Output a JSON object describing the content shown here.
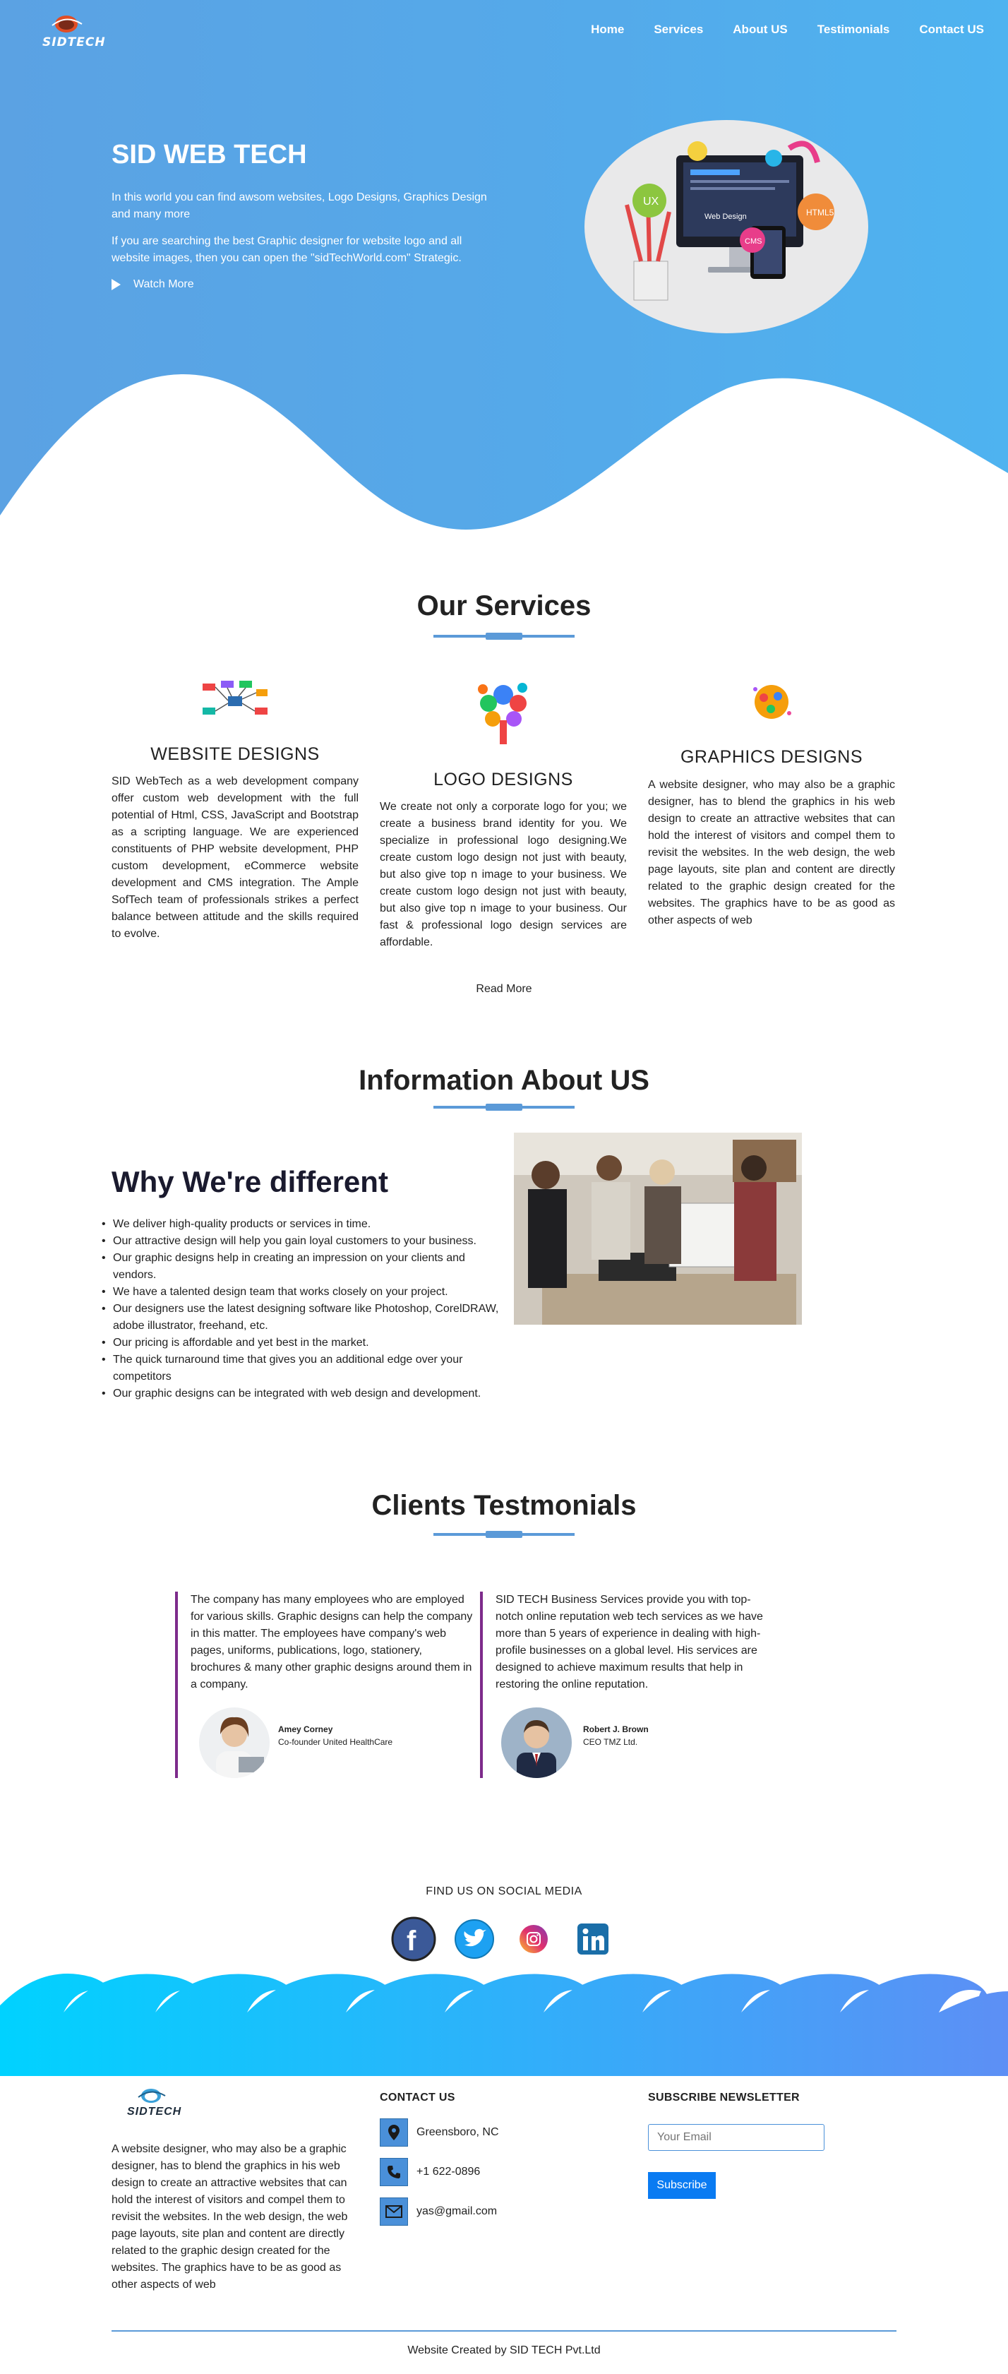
{
  "brand": {
    "logo_text": "SIDTECH"
  },
  "nav": [
    "Home",
    "Services",
    "About US",
    "Testimonials",
    "Contact US"
  ],
  "hero": {
    "title": "SID WEB TECH",
    "p1": "In this world you can find awsom websites, Logo Designs, Graphics Design and many more",
    "p2": "If you are searching the best Graphic designer for website logo and all website images, then you can open the \"sidTechWorld.com\" Strategic.",
    "watch_label": "Watch More",
    "illustration_labels": [
      "UX",
      "HTML5",
      "CMS",
      "Web Design"
    ]
  },
  "services": {
    "title": "Our Services",
    "items": [
      {
        "title": "WEBSITE DESIGNS",
        "text": "SID WebTech as a web development company offer custom web development with the full potential of Html, CSS, JavaScript and Bootstrap as a scripting language. We are experienced constituents of PHP website development, PHP custom development, eCommerce website development and CMS integration. The Ample SofTech team of professionals strikes a perfect balance between attitude and the skills required to evolve."
      },
      {
        "title": "LOGO DESIGNS",
        "text": "We create not only a corporate logo for you; we create a business brand identity for you. We specialize in professional logo designing.We create custom logo design not just with beauty, but also give top n image to your business. We create custom logo design not just with beauty, but also give top n image to your business. Our fast & professional logo design services are affordable."
      },
      {
        "title": "GRAPHICS DESIGNS",
        "text": "A website designer, who may also be a graphic designer, has to blend the graphics in his web design to create an attractive websites that can hold the interest of visitors and compel them to revisit the websites. In the web design, the web page layouts, site plan and content are directly related to the graphic design created for the websites. The graphics have to be as good as other aspects of web"
      }
    ],
    "read_more": "Read More"
  },
  "about": {
    "title": "Information About US",
    "heading": "Why We're different",
    "points": [
      "We deliver high-quality products or services in time.",
      "Our attractive design will help you gain loyal customers to your business.",
      "Our graphic designs help in creating an impression on your clients and vendors.",
      "We have a talented design team that works closely on your project.",
      "Our designers use the latest designing software like Photoshop, CorelDRAW, adobe illustrator, freehand, etc.",
      "Our pricing is affordable and yet best in the market.",
      "The quick turnaround time that gives you an additional edge over your competitors",
      "Our graphic designs can be integrated with web design and development."
    ]
  },
  "testimonials": {
    "title": "Clients Testmonials",
    "items": [
      {
        "text": "The company has many employees who are employed for various skills. Graphic designs can help the company in this matter. The employees have company's web pages, uniforms, publications, logo, stationery, brochures & many other graphic designs around them in a company.",
        "name": "Amey Corney",
        "role": "Co-founder United HealthCare"
      },
      {
        "text": "SID TECH Business Services provide you with top-notch online reputation web tech services as we have more than 5 years of experience in dealing with high-profile businesses on a global level. His services are designed to achieve maximum results that help in restoring the online reputation.",
        "name": "Robert J. Brown",
        "role": "CEO TMZ Ltd."
      }
    ]
  },
  "social": {
    "title": "FIND US ON SOCIAL MEDIA",
    "icons": [
      "facebook-icon",
      "twitter-icon",
      "instagram-icon",
      "linkedin-icon"
    ]
  },
  "footer": {
    "logo_text": "SIDTECH",
    "about": "A website designer, who may also be a graphic designer, has to blend the graphics in his web design to create an attractive websites that can hold the interest of visitors and compel them to revisit the websites. In the web design, the web page layouts, site plan and content are directly related to the graphic design created for the websites. The graphics have to be as good as other aspects of web",
    "contact_title": "CONTACT US",
    "address": "Greensboro, NC",
    "phone": "+1 622-0896",
    "email": "yas@gmail.com",
    "newsletter_title": "SUBSCRIBE NEWSLETTER",
    "email_placeholder": "Your Email",
    "subscribe_label": "Subscribe",
    "credit": "Website Created by SID TECH Pvt.Ltd"
  },
  "colors": {
    "hero_blue": "#54aaea",
    "accent": "#5b9ad8",
    "button": "#0a7bf2",
    "testimonial_border": "#7d2b8b",
    "wave": "#00c8f5"
  }
}
